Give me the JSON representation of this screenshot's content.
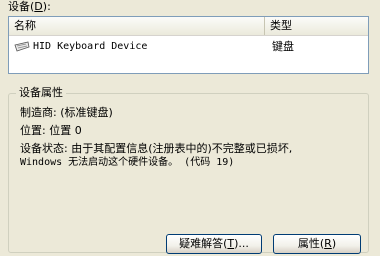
{
  "device_list": {
    "label": "设备",
    "hotkey": "D",
    "label_suffix": "):",
    "label_open": "(",
    "columns": [
      "名称",
      "类型"
    ],
    "rows": [
      {
        "icon": "keyboard-icon",
        "name": "HID Keyboard Device",
        "type": "键盘"
      }
    ]
  },
  "properties": {
    "title": "设备属性",
    "manufacturer": "制造商: (标准键盘)",
    "location": "位置: 位置 0",
    "status_line1": "设备状态: 由于其配置信息(注册表中的)不完整或已损坏,",
    "status_line2": "Windows 无法启动这个硬件设备。 (代码 19)"
  },
  "buttons": {
    "troubleshoot": {
      "text": "疑难解答(",
      "hotkey": "T",
      "suffix": ")..."
    },
    "properties": {
      "text": "属性(",
      "hotkey": "R",
      "suffix": ")"
    }
  }
}
